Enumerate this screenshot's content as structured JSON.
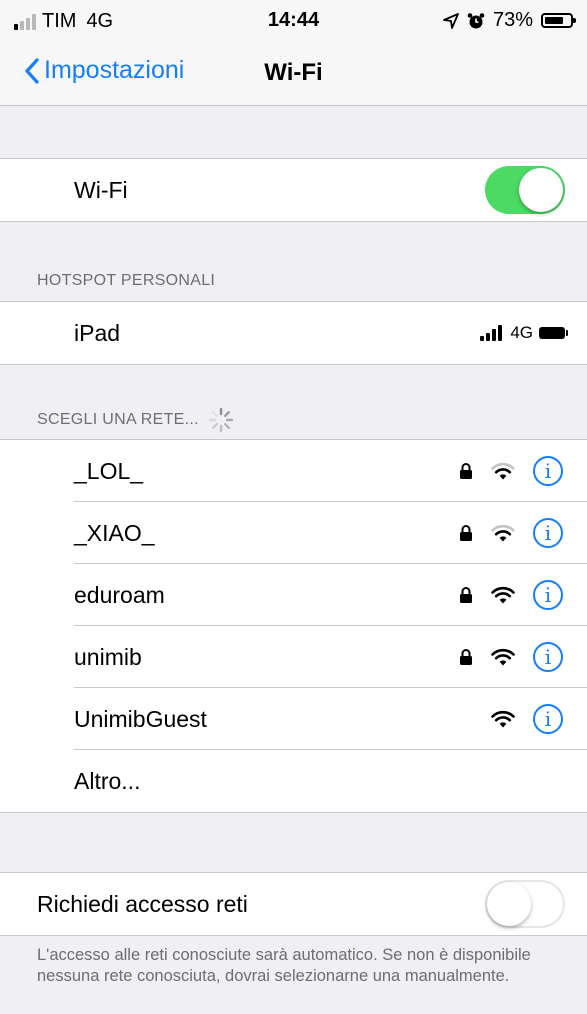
{
  "status_bar": {
    "carrier": "TIM",
    "network": "4G",
    "time": "14:44",
    "battery_percent": "73%",
    "battery_level": 0.73,
    "location_icon": "location-arrow-icon",
    "alarm_icon": "alarm-clock-icon"
  },
  "nav": {
    "back_label": "Impostazioni",
    "title": "Wi-Fi"
  },
  "wifi": {
    "label": "Wi-Fi",
    "enabled": true,
    "toggle_color": "#4cd964"
  },
  "hotspot": {
    "header": "HOTSPOT PERSONALI",
    "device": "iPad",
    "network": "4G"
  },
  "networks": {
    "header": "SCEGLI UNA RETE...",
    "items": [
      {
        "name": "_LOL_",
        "locked": true,
        "signal": 2
      },
      {
        "name": "_XIAO_",
        "locked": true,
        "signal": 2
      },
      {
        "name": "eduroam",
        "locked": true,
        "signal": 3
      },
      {
        "name": "unimib",
        "locked": true,
        "signal": 3
      },
      {
        "name": "UnimibGuest",
        "locked": false,
        "signal": 3
      }
    ],
    "other_label": "Altro..."
  },
  "ask_join": {
    "label": "Richiedi accesso reti",
    "enabled": false,
    "footer": "L'accesso alle reti conosciute sarà automatico. Se non è disponibile nessuna rete conosciuta, dovrai selezionarne una manualmente."
  },
  "colors": {
    "accent": "#157efb",
    "background": "#efeff4",
    "separator": "#c8c7cc"
  }
}
